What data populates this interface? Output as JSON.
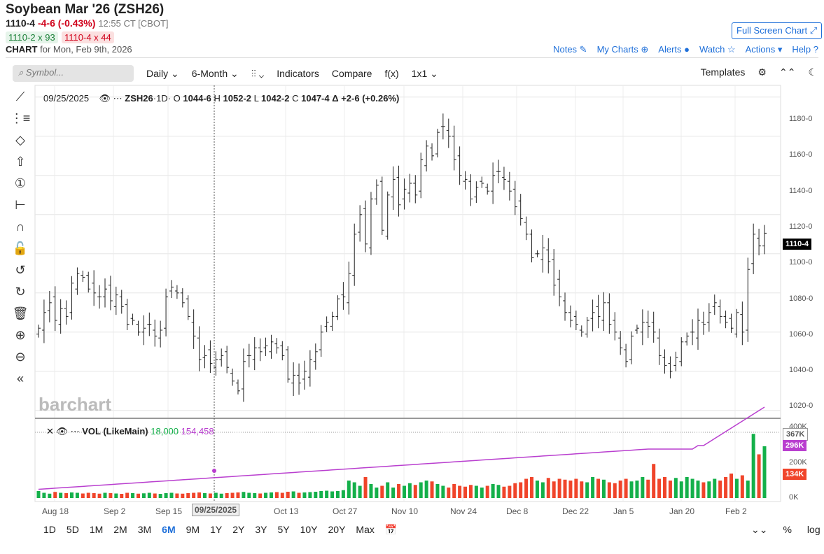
{
  "header": {
    "title": "Soybean Mar '26 (ZSH26)",
    "last": "1110-4",
    "change": "-4-6 (-0.43%)",
    "time": "12:55 CT [CBOT]",
    "bid": "1110-2 x 93",
    "ask": "1110-4 x 44",
    "chart_label": "CHART",
    "chart_date": "for Mon, Feb 9th, 2026",
    "fullscreen": "Full Screen Chart ⤢"
  },
  "links": [
    "Notes ✎",
    "My Charts ⊕",
    "Alerts ●",
    "Watch ☆",
    "Actions ▾",
    "Help ?"
  ],
  "toolbar": {
    "search_placeholder": "Symbol...",
    "interval": "Daily ⌄",
    "period": "6-Month ⌄",
    "bars": "⫶⫶ ⌄",
    "indicators": "Indicators",
    "compare": "Compare",
    "fx": "f(x)",
    "layout": "1x1 ⌄",
    "templates": "Templates",
    "gear": "⚙",
    "collapse": "⌃⌃",
    "theme": "☾"
  },
  "left_tools": [
    "⟋",
    "⋮≡",
    "◇",
    "⇧",
    "①",
    "⊢",
    "∩",
    "🔓",
    "↺",
    "↻",
    "🗑",
    "⊕",
    "⊖",
    "«"
  ],
  "legend": {
    "date": "09/25/2025",
    "symbol": "ZSH26",
    "interval": "·1D·",
    "o_label": "O",
    "o": "1044-6",
    "h_label": "H",
    "h": "1052-2",
    "l_label": "L",
    "l": "1042-2",
    "c_label": "C",
    "c": "1047-4",
    "delta": "Δ +2-6 (+0.26%)"
  },
  "vol_legend": {
    "name": "VOL (LikeMain)",
    "v1": "18,000",
    "v2": "154,458"
  },
  "watermark": "barchart",
  "price_axis": [
    "1180-0",
    "1160-0",
    "1140-0",
    "1120-0",
    "1100-0",
    "1080-0",
    "1060-0",
    "1040-0",
    "1020-0"
  ],
  "price_tag": "1110-4",
  "vol_axis": [
    "400K",
    "200K",
    "0K"
  ],
  "vol_tags": {
    "max": "367K",
    "avg": "296K",
    "last": "134K"
  },
  "x_labels": [
    "Aug 18",
    "Sep 2",
    "Sep 15",
    "09/25/2025",
    "Oct 13",
    "Oct 27",
    "Nov 10",
    "Nov 24",
    "Dec 8",
    "Dec 22",
    "Jan 5",
    "Jan 20",
    "Feb 2"
  ],
  "ranges": [
    "1D",
    "5D",
    "1M",
    "2M",
    "3M",
    "6M",
    "9M",
    "1Y",
    "2Y",
    "3Y",
    "5Y",
    "10Y",
    "20Y",
    "Max",
    "📅"
  ],
  "range_active": "6M",
  "bottom_right": [
    "⌄⌄",
    "%",
    "log"
  ],
  "colors": {
    "up": "#14b04a",
    "down": "#f0442a",
    "avg": "#b93fcf",
    "accent": "#1e6fd9"
  },
  "chart_data": {
    "type": "ohlc",
    "ylim": [
      1016,
      1186
    ],
    "closes": [
      1062,
      1070,
      1075,
      1066,
      1072,
      1068,
      1085,
      1090,
      1088,
      1082,
      1080,
      1078,
      1082,
      1076,
      1079,
      1073,
      1064,
      1066,
      1060,
      1062,
      1064,
      1058,
      1061,
      1078,
      1083,
      1080,
      1075,
      1068,
      1058,
      1046,
      1048,
      1044,
      1046,
      1048,
      1042,
      1035,
      1030,
      1045,
      1048,
      1052,
      1050,
      1053,
      1055,
      1052,
      1048,
      1036,
      1038,
      1034,
      1040,
      1046,
      1050,
      1060,
      1065,
      1068,
      1077,
      1078,
      1090,
      1110,
      1120,
      1105,
      1128,
      1135,
      1112,
      1130,
      1138,
      1125,
      1133,
      1136,
      1130,
      1148,
      1155,
      1150,
      1162,
      1165,
      1160,
      1148,
      1140,
      1138,
      1128,
      1134,
      1136,
      1132,
      1140,
      1142,
      1138,
      1132,
      1124,
      1118,
      1110,
      1098,
      1100,
      1103,
      1096,
      1084,
      1078,
      1070,
      1066,
      1064,
      1060,
      1066,
      1070,
      1068,
      1075,
      1064,
      1060,
      1052,
      1045,
      1058,
      1062,
      1065,
      1063,
      1060,
      1048,
      1043,
      1040,
      1047,
      1055,
      1058,
      1060,
      1066,
      1064,
      1070,
      1075,
      1068,
      1065,
      1062,
      1070,
      1060,
      1092,
      1110,
      1104,
      1110.5
    ],
    "volumes": [
      40,
      30,
      25,
      35,
      30,
      28,
      32,
      30,
      26,
      30,
      28,
      25,
      30,
      28,
      26,
      24,
      30,
      28,
      25,
      27,
      30,
      26,
      24,
      28,
      30,
      26,
      25,
      28,
      30,
      32,
      28,
      26,
      30,
      25,
      28,
      30,
      32,
      35,
      30,
      28,
      26,
      30,
      32,
      34,
      30,
      36,
      38,
      30,
      32,
      34,
      36,
      40,
      42,
      38,
      40,
      45,
      100,
      90,
      70,
      120,
      80,
      60,
      70,
      90,
      60,
      80,
      70,
      85,
      75,
      90,
      100,
      95,
      80,
      70,
      60,
      80,
      70,
      65,
      75,
      70,
      60,
      70,
      80,
      75,
      65,
      70,
      85,
      90,
      110,
      120,
      100,
      90,
      115,
      95,
      110,
      105,
      100,
      110,
      95,
      90,
      120,
      110,
      105,
      90,
      85,
      100,
      110,
      95,
      100,
      120,
      105,
      195,
      110,
      120,
      100,
      115,
      95,
      120,
      110,
      100,
      90,
      95,
      110,
      100,
      120,
      140,
      110,
      130,
      100,
      367,
      250,
      296,
      134
    ]
  }
}
